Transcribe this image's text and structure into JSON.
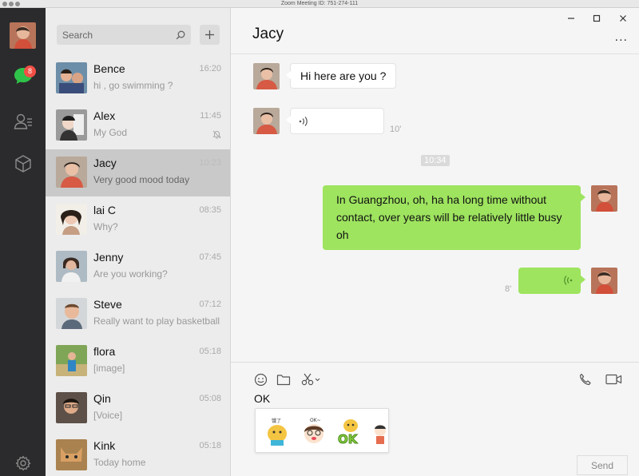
{
  "window": {
    "title": "Zoom Meeting ID: 751-274-111"
  },
  "rail": {
    "chat_badge": "8"
  },
  "search": {
    "placeholder": "Search"
  },
  "chats": [
    {
      "name": "Bence",
      "time": "16:20",
      "message": "hi , go swimming ?"
    },
    {
      "name": "Alex",
      "time": "11:45",
      "message": "My God",
      "muted": true
    },
    {
      "name": "Jacy",
      "time": "10:23",
      "message": "Very good mood today",
      "active": true
    },
    {
      "name": "lai C",
      "time": "08:35",
      "message": "Why?"
    },
    {
      "name": "Jenny",
      "time": "07:45",
      "message": "Are you working?"
    },
    {
      "name": "Steve",
      "time": "07:12",
      "message": "Really want to play basketball"
    },
    {
      "name": "flora",
      "time": "05:18",
      "message": "[image]"
    },
    {
      "name": "Qin",
      "time": "05:08",
      "message": "[Voice]"
    },
    {
      "name": "Kink",
      "time": "05:18",
      "message": "Today home"
    }
  ],
  "conversation": {
    "title": "Jacy",
    "more": "...",
    "messages": {
      "m1_text": "Hi here are you ?",
      "m2_duration": "10'",
      "timestamp": "10:34",
      "m3_line1": "In Guangzhou, oh, ha ha long time without",
      "m3_line2": "contact, over years will be relatively little busy",
      "m3_line3": "oh",
      "m4_duration": "8'"
    }
  },
  "composer": {
    "input_value": "OK",
    "send_label": "Send",
    "stickers": [
      "sticker-1",
      "sticker-2",
      "sticker-ok",
      "sticker-4"
    ]
  },
  "colors": {
    "accent_green": "#9ee45f",
    "badge_red": "#f25045",
    "rail_bg": "#2b2b2d"
  }
}
